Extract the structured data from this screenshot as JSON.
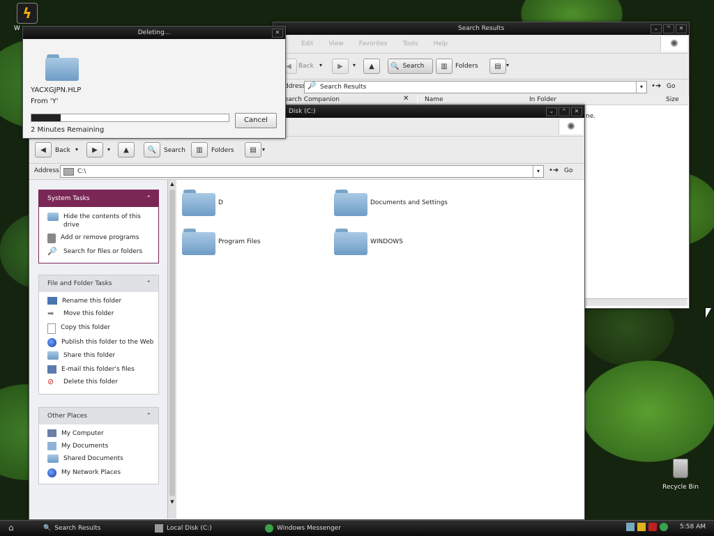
{
  "desktop": {
    "top_left_label": "W",
    "recycle_bin_label": "Recycle Bin"
  },
  "deleting_dialog": {
    "title": "Deleting...",
    "file_name": "YACXGJPN.HLP",
    "from_text": "From 'Y'",
    "progress": 0.15,
    "time_remaining": "2 Minutes Remaining",
    "cancel_label": "Cancel"
  },
  "search_window": {
    "title": "Search Results",
    "menu": [
      "Edit",
      "View",
      "Favorites",
      "Tools",
      "Help"
    ],
    "back_label": "Back",
    "search_label": "Search",
    "folders_label": "Folders",
    "address_label": "Address",
    "address_value": "Search Results",
    "go_label": "Go",
    "pane_title": "Search Companion",
    "columns": [
      "Name",
      "In Folder",
      "Size"
    ],
    "message": "ne."
  },
  "explorer_window": {
    "title": "Disk (C:)",
    "back_label": "Back",
    "search_label": "Search",
    "folders_label": "Folders",
    "address_label": "Address",
    "address_value": "C:\\",
    "go_label": "Go",
    "system_tasks": {
      "title": "System Tasks",
      "items": [
        "Hide the contents of this drive",
        "Add or remove programs",
        "Search for files or folders"
      ]
    },
    "file_folder_tasks": {
      "title": "File and Folder Tasks",
      "items": [
        "Rename this folder",
        "Move this folder",
        "Copy this folder",
        "Publish this folder to the Web",
        "Share this folder",
        "E-mail this folder's files",
        "Delete this folder"
      ]
    },
    "other_places": {
      "title": "Other Places",
      "items": [
        "My Computer",
        "My Documents",
        "Shared Documents",
        "My Network Places"
      ]
    },
    "folders": [
      "D",
      "Documents and Settings",
      "Program Files",
      "WINDOWS"
    ]
  },
  "taskbar": {
    "items": [
      "Search Results",
      "Local Disk (C:)",
      "Windows Messenger"
    ],
    "clock": "5:58 AM"
  },
  "colors": {
    "system_tasks_header": "#7a2756",
    "taskbar": "#1a1a1a",
    "titlebar": "#1a1a1a"
  }
}
